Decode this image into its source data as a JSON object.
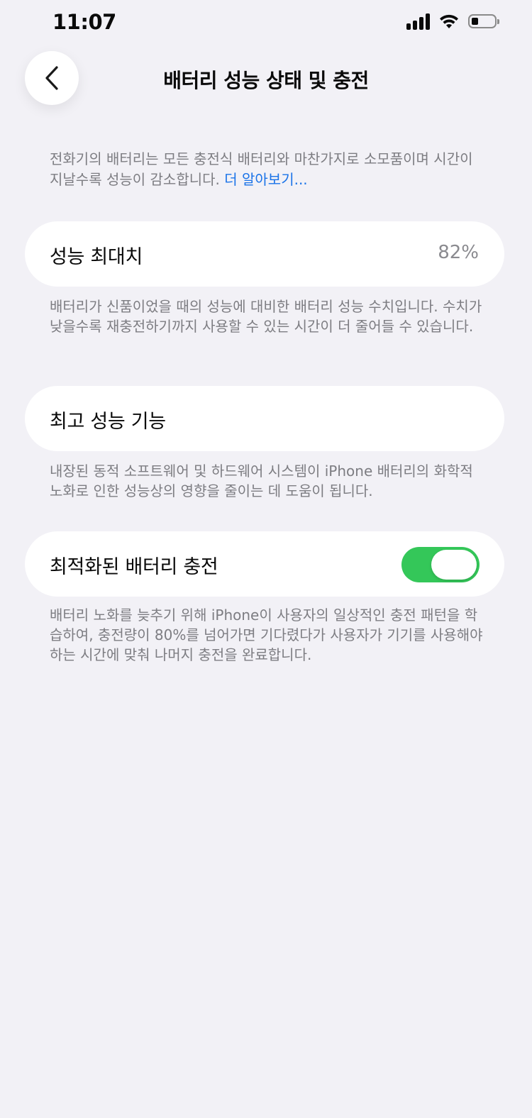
{
  "status_bar": {
    "time": "11:07",
    "icons": [
      "cellular-signal-icon",
      "wifi-icon",
      "battery-icon"
    ]
  },
  "nav": {
    "title": "배터리 성능 상태 및 충전",
    "back_icon": "chevron-left-icon"
  },
  "intro": {
    "text": "전화기의 배터리는 모든 충전식 배터리와 마찬가지로 소모품이며 시간이 지날수록 성능이 감소합니다. ",
    "link": "더 알아보기..."
  },
  "maximum_capacity": {
    "label": "성능 최대치",
    "value": "82%",
    "footnote": "배터리가 신품이었을 때의 성능에 대비한 배터리 성능 수치입니다. 수치가 낮을수록 재충전하기까지 사용할 수 있는 시간이 더 줄어들 수 있습니다."
  },
  "peak_performance": {
    "label": "최고 성능 기능",
    "footnote": "내장된 동적 소프트웨어 및 하드웨어 시스템이 iPhone 배터리의 화학적 노화로 인한 성능상의 영향을 줄이는 데 도움이 됩니다."
  },
  "optimized_charging": {
    "label": "최적화된 배터리 충전",
    "enabled": true,
    "footnote": "배터리 노화를 늦추기 위해 iPhone이 사용자의 일상적인 충전 패턴을 학습하여, 충전량이 80%를 넘어가면 기다렸다가 사용자가 기기를 사용해야 하는 시간에 맞춰 나머지 충전을 완료합니다."
  },
  "colors": {
    "background": "#F2F1F6",
    "toggle_on": "#34C759",
    "link": "#1A73E8",
    "secondary_text": "#7D7D82"
  }
}
